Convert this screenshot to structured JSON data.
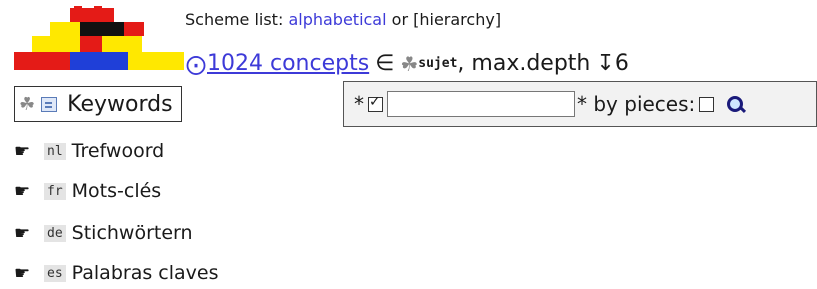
{
  "header": {
    "scheme_label": "Scheme list:",
    "alphabetical_link": "alphabetical",
    "or_text": "or",
    "hierarchy_text": "[hierarchy]",
    "target_glyph": "⨀",
    "concepts_count": "1024 concepts",
    "element_of": "∈",
    "scheme_icon": "trefoil-icon",
    "scheme_name": "sujet",
    "depth_text": ", max.depth",
    "depth_arrow": "↧",
    "depth_value": "6"
  },
  "keywords": {
    "label": "Keywords"
  },
  "search": {
    "prefix_star": "*",
    "input_value": "",
    "suffix_text": "* by pieces:",
    "case_checked": true,
    "pieces_checked": false
  },
  "languages": [
    {
      "code": "nl",
      "label": "Trefwoord"
    },
    {
      "code": "fr",
      "label": "Mots-clés"
    },
    {
      "code": "de",
      "label": "Stichwörtern"
    },
    {
      "code": "es",
      "label": "Palabras claves"
    }
  ],
  "colors": {
    "link": "#3d3ad8",
    "logo_red": "#e41b17",
    "logo_yellow": "#ffe800",
    "logo_blue": "#1f3fd8",
    "logo_black": "#111111"
  }
}
